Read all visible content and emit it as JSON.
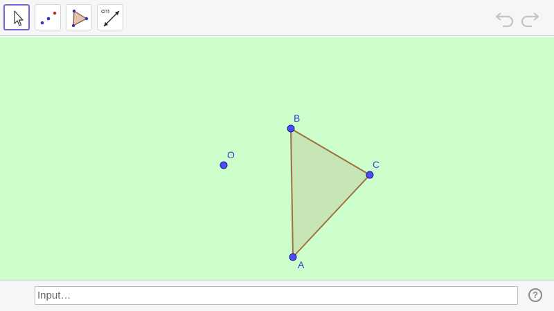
{
  "toolbar": {
    "tools": [
      {
        "icon": "move-arrow-icon",
        "active": true
      },
      {
        "icon": "point-icon",
        "active": false
      },
      {
        "icon": "polygon-icon",
        "active": false
      },
      {
        "icon": "distance-icon",
        "active": false,
        "label": "cm"
      }
    ],
    "undo_icon": "undo-icon",
    "redo_icon": "redo-icon"
  },
  "graphics": {
    "background_color": "#ccffcc",
    "point_color": "#4d4dff",
    "polygon_fill": "#c6e6b6",
    "polygon_stroke": "#a0703c",
    "label_color": "#3b3bd6",
    "points": [
      {
        "name": "O",
        "label": "O"
      },
      {
        "name": "B",
        "label": "B"
      },
      {
        "name": "C",
        "label": "C"
      },
      {
        "name": "A",
        "label": "A"
      }
    ],
    "polygon": [
      "A",
      "B",
      "C"
    ]
  },
  "inputbar": {
    "placeholder": "Input…",
    "value": "",
    "help_label": "?"
  }
}
